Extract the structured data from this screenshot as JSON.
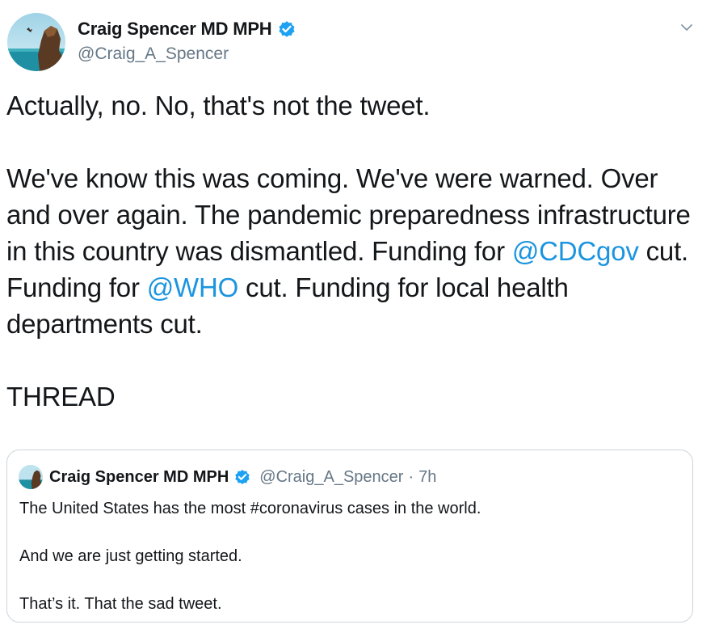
{
  "tweet": {
    "display_name": "Craig Spencer MD MPH",
    "handle": "@Craig_A_Spencer",
    "body": {
      "line1": "Actually, no. No, that's not the tweet.",
      "para2_part1": "We've know this was coming. We've were warned. Over and over again. The pandemic preparedness infrastructure in this country was dismantled. Funding for ",
      "mention1": "@CDCgov",
      "para2_part2": " cut. Funding for ",
      "mention2": "@WHO",
      "para2_part3": " cut. Funding for local health departments cut.",
      "line3": "THREAD"
    }
  },
  "quoted_tweet": {
    "display_name": "Craig Spencer MD MPH",
    "handle": "@Craig_A_Spencer",
    "separator": "·",
    "time": "7h",
    "lines": [
      "The United States has the most #coronavirus cases in the world.",
      "And we are just getting started.",
      "That’s it. That the sad tweet."
    ]
  },
  "icons": {
    "verified": "verified-badge-icon",
    "caret": "chevron-down-icon"
  },
  "colors": {
    "link": "#1b95e0",
    "verified": "#1da1f2",
    "secondary_text": "#657786",
    "border": "#ccd6dd"
  }
}
